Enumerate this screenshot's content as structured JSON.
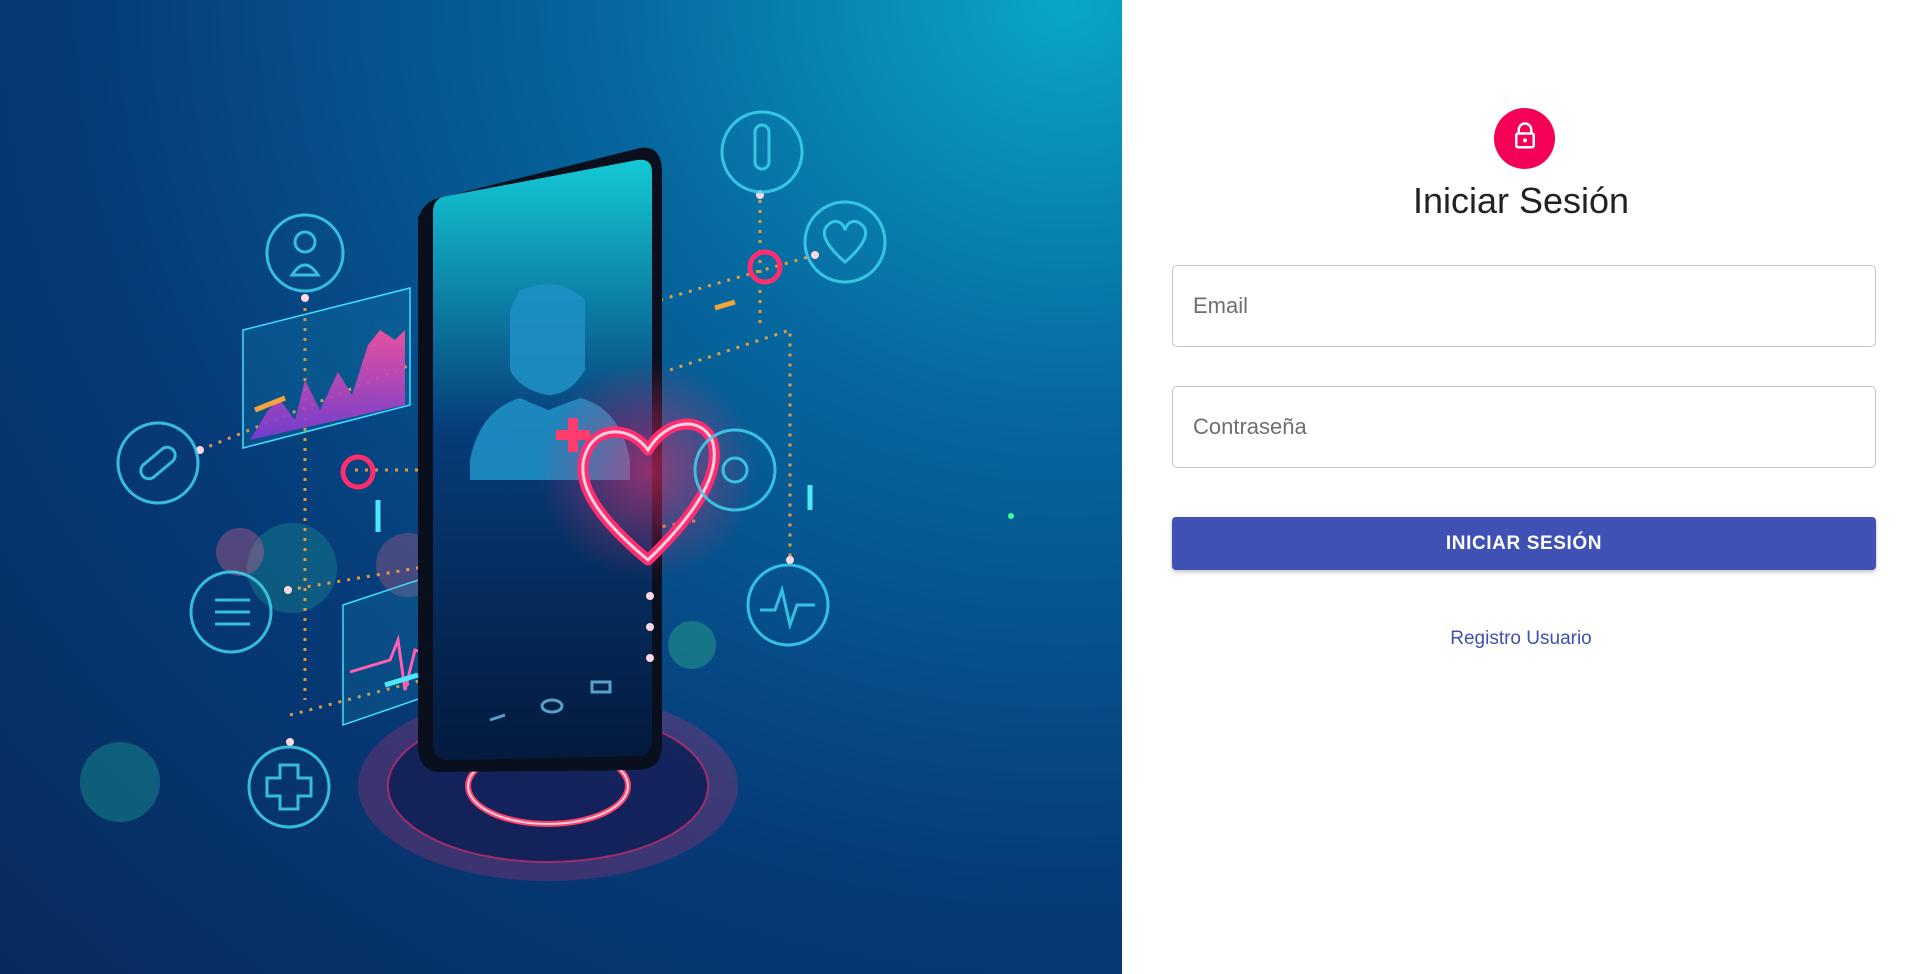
{
  "hero": {
    "theme_colors": {
      "neon_pink": "#ff2d6f",
      "neon_cyan": "#4de8ff",
      "deep_blue": "#063a78"
    },
    "icons": [
      "user-icon",
      "pill-icon",
      "list-icon",
      "cross-icon",
      "thermometer-icon",
      "heart-outline-icon",
      "stethoscope-icon",
      "ecg-icon",
      "doctor-icon",
      "neon-heart-icon"
    ]
  },
  "login": {
    "lock_icon": "lock-icon",
    "title": "Iniciar Sesión",
    "email_placeholder": "Email",
    "password_placeholder": "Contraseña",
    "submit_label": "INICIAR SESIÓN",
    "register_label": "Registro Usuario",
    "colors": {
      "accent": "#f50057",
      "primary": "#3f51b5"
    }
  }
}
